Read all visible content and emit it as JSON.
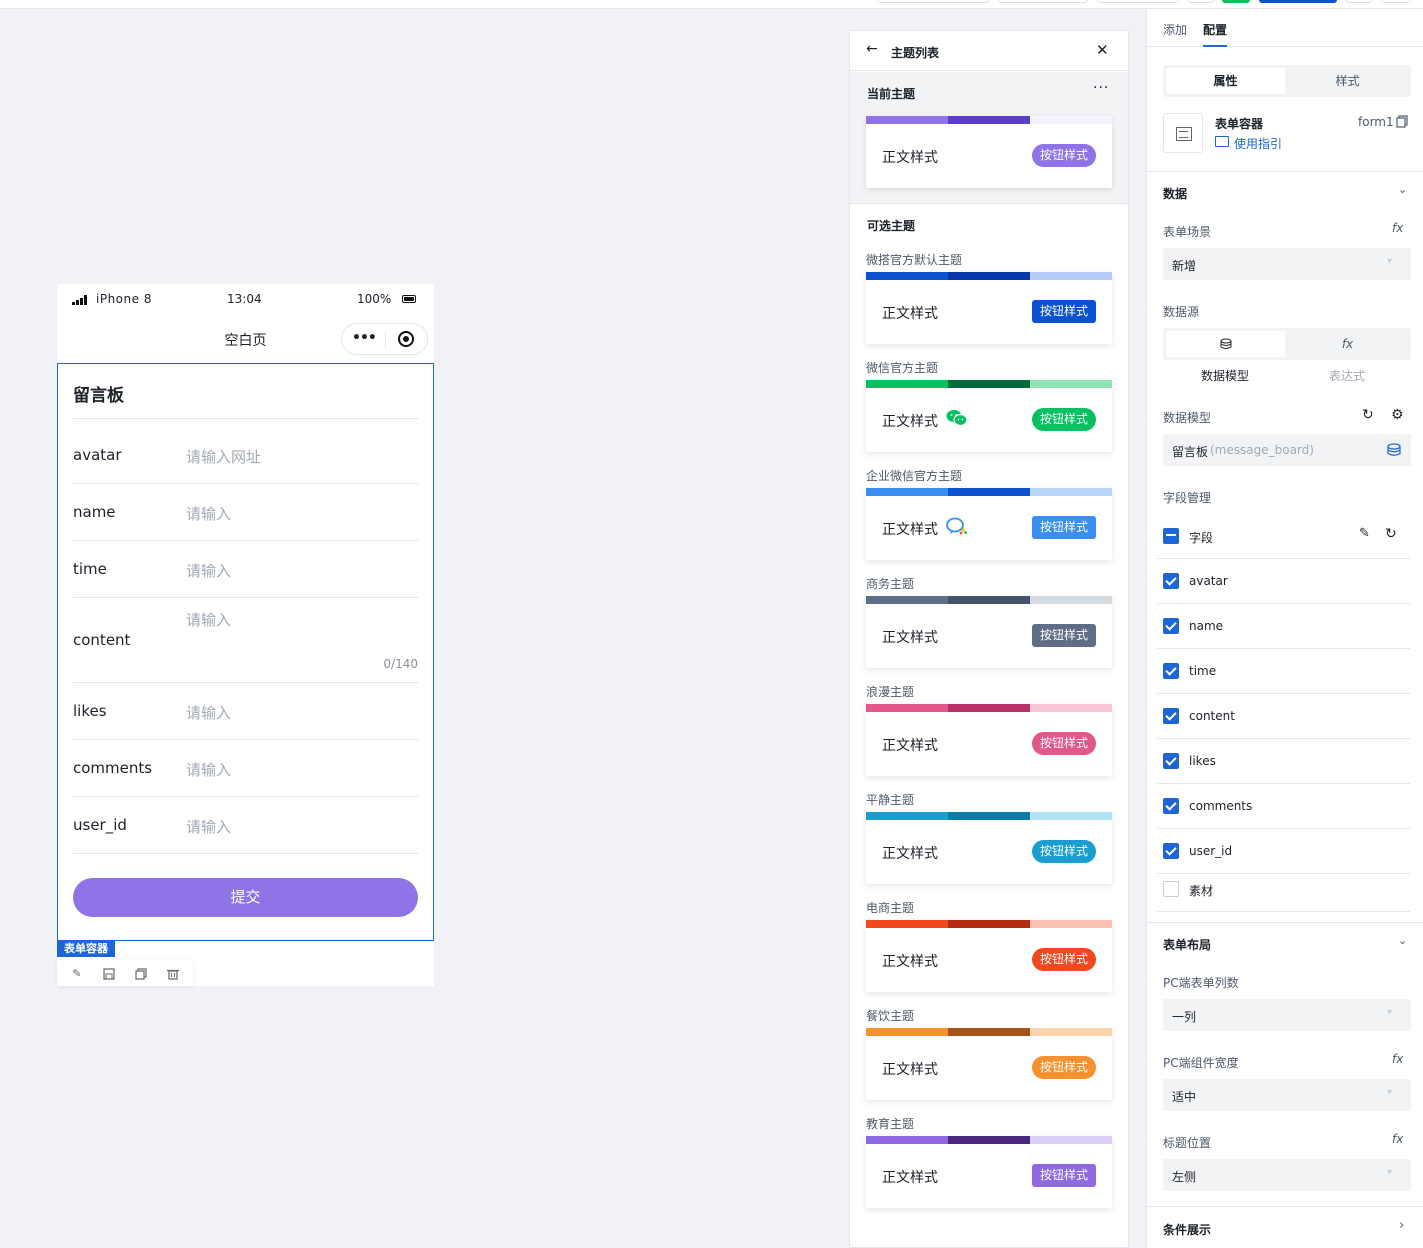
{
  "phone": {
    "carrier": "iPhone 8",
    "clock": "13:04",
    "battery": "100%",
    "page_title": "空白页",
    "form_title": "留言板",
    "fields": [
      {
        "label": "avatar",
        "placeholder": "请输入网址"
      },
      {
        "label": "name",
        "placeholder": "请输入"
      },
      {
        "label": "time",
        "placeholder": "请输入"
      },
      {
        "label": "content",
        "placeholder": "请输入",
        "counter": "0/140"
      },
      {
        "label": "likes",
        "placeholder": "请输入"
      },
      {
        "label": "comments",
        "placeholder": "请输入"
      },
      {
        "label": "user_id",
        "placeholder": "请输入"
      }
    ],
    "submit_label": "提交",
    "selected_tag": "表单容器"
  },
  "theme_panel": {
    "title": "主题列表",
    "current_heading": "当前主题",
    "optional_heading": "可选主题",
    "body_text": "正文样式",
    "button_text": "按钮样式",
    "current": {
      "colors": [
        "#8e74e6",
        "#5b3fc8",
        "#f6f2ff"
      ],
      "button_color": "#8e74e6"
    },
    "themes": [
      {
        "name": "微搭官方默认主题",
        "colors": [
          "#0a52d0",
          "#0638a8",
          "#b6cdf9"
        ],
        "button_color": "#0a52d0"
      },
      {
        "name": "微信官方主题",
        "colors": [
          "#07c160",
          "#056b3c",
          "#8ee4b4"
        ],
        "button_color": "#07c160",
        "icon": "wechat-icon"
      },
      {
        "name": "企业微信官方主题",
        "colors": [
          "#3a8ef0",
          "#0a52d0",
          "#b8d6fa"
        ],
        "button_color": "#3a8ef0",
        "icon": "wecom-icon"
      },
      {
        "name": "商务主题",
        "colors": [
          "#5f6d86",
          "#46536c",
          "#d5d9e0"
        ],
        "button_color": "#5f6d86"
      },
      {
        "name": "浪漫主题",
        "colors": [
          "#e4578a",
          "#b9326a",
          "#f9c7d9"
        ],
        "button_color": "#e4578a"
      },
      {
        "name": "平静主题",
        "colors": [
          "#1b9dd1",
          "#0e7aa6",
          "#b0e3f5"
        ],
        "button_color": "#1b9dd1"
      },
      {
        "name": "电商主题",
        "colors": [
          "#f0491f",
          "#b42d11",
          "#fbc1b0"
        ],
        "button_color": "#f0491f"
      },
      {
        "name": "餐饮主题",
        "colors": [
          "#f7912f",
          "#a55316",
          "#fcd3ab"
        ],
        "button_color": "#f7912f"
      },
      {
        "name": "教育主题",
        "colors": [
          "#8e6ae0",
          "#48297e",
          "#dccff6"
        ],
        "button_color": "#8e6ae0"
      }
    ]
  },
  "config_panel": {
    "tabs": [
      "添加",
      "配置"
    ],
    "segments": [
      "属性",
      "样式"
    ],
    "component_name": "表单容器",
    "component_id": "form1",
    "guide_link": "使用指引",
    "data_section": "数据",
    "form_scene_label": "表单场景",
    "form_scene_value": "新增",
    "datasource_label": "数据源",
    "datasource_tabs": [
      "数据模型",
      "表达式"
    ],
    "model_label": "数据模型",
    "model_value": "留言板",
    "model_key": "(message_board)",
    "field_mgmt_label": "字段管理",
    "field_header": "字段",
    "fields": [
      {
        "name": "avatar",
        "checked": true
      },
      {
        "name": "name",
        "checked": true
      },
      {
        "name": "time",
        "checked": true
      },
      {
        "name": "content",
        "checked": true
      },
      {
        "name": "likes",
        "checked": true
      },
      {
        "name": "comments",
        "checked": true
      },
      {
        "name": "user_id",
        "checked": true
      },
      {
        "name": "素材",
        "checked": false
      }
    ],
    "layout_section": "表单布局",
    "pc_columns_label": "PC端表单列数",
    "pc_columns_value": "一列",
    "pc_width_label": "PC端组件宽度",
    "pc_width_value": "适中",
    "title_pos_label": "标题位置",
    "title_pos_value": "左侧",
    "condition_section": "条件展示",
    "fx_label": "fx"
  }
}
